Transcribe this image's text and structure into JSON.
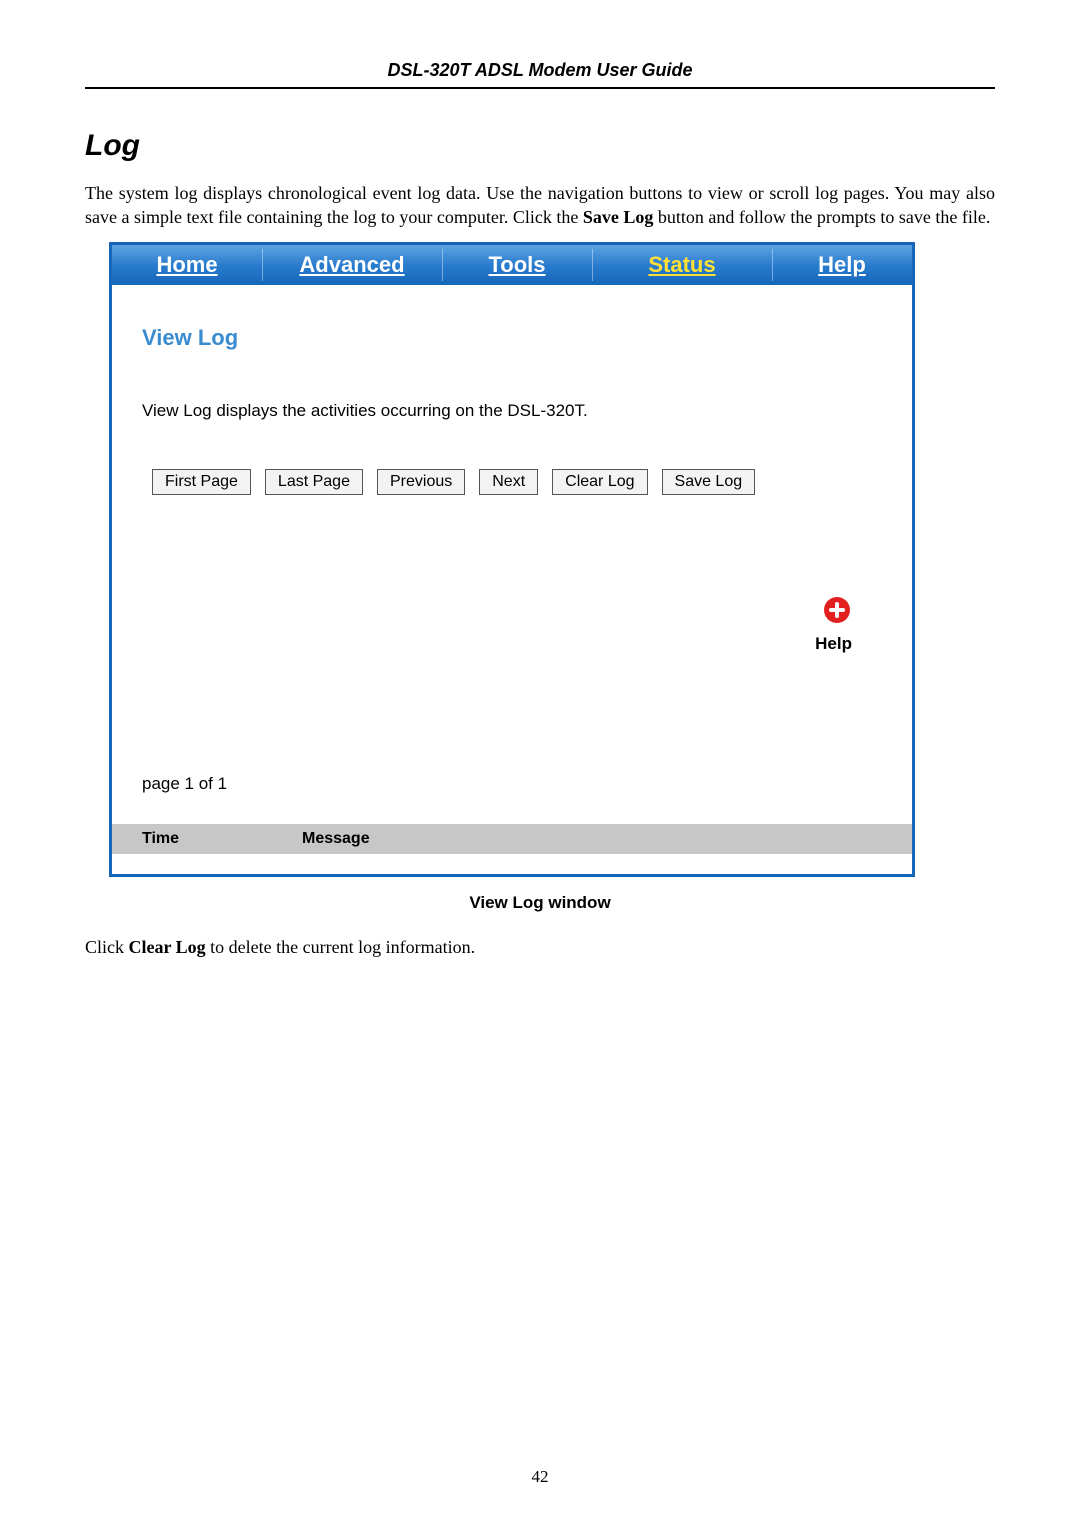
{
  "doc": {
    "header_title": "DSL-320T ADSL Modem User Guide",
    "section_heading": "Log",
    "intro_para_pre": "The system log displays chronological event log data. Use the navigation buttons to view or scroll log pages. You may also save a simple text file containing the log to your computer. Click the ",
    "intro_para_bold": "Save Log",
    "intro_para_post": " button and follow the prompts to save the file.",
    "caption": "View Log window",
    "footer_pre": "Click ",
    "footer_bold": "Clear Log",
    "footer_post": " to delete the current log information.",
    "page_number": "42"
  },
  "router": {
    "tabs": {
      "home": "Home",
      "advanced": "Advanced",
      "tools": "Tools",
      "status": "Status",
      "help": "Help"
    },
    "panel_title": "View Log",
    "panel_desc": "View Log displays the activities occurring on the DSL-320T.",
    "buttons": {
      "first": "First Page",
      "last": "Last Page",
      "prev": "Previous",
      "next": "Next",
      "clear": "Clear Log",
      "save": "Save Log"
    },
    "help_label": "Help",
    "page_of": "page 1 of 1",
    "columns": {
      "time": "Time",
      "message": "Message"
    }
  }
}
